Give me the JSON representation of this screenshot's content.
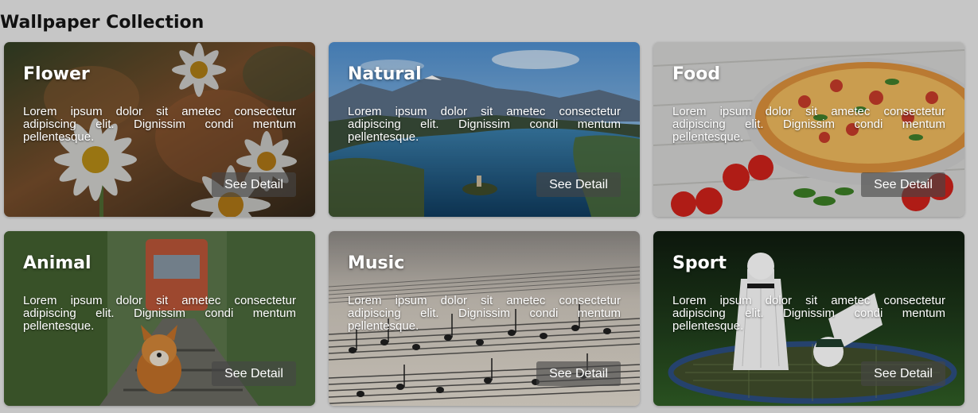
{
  "page": {
    "title": "Wallpaper Collection"
  },
  "cards": [
    {
      "title": "Flower",
      "description": "Lorem ipsum dolor sit ametec consectetur adipiscing elit. Dignissim condi mentum pellentesque.",
      "button": "See Detail"
    },
    {
      "title": "Natural",
      "description": "Lorem ipsum dolor sit ametec consectetur adipiscing elit. Dignissim condi mentum pellentesque.",
      "button": "See Detail"
    },
    {
      "title": "Food",
      "description": "Lorem ipsum dolor sit ametec consectetur adipiscing elit. Dignissim condi mentum pellentesque.",
      "button": "See Detail"
    },
    {
      "title": "Animal",
      "description": "Lorem ipsum dolor sit ametec consectetur adipiscing elit. Dignissim condi mentum pellentesque.",
      "button": "See Detail"
    },
    {
      "title": "Music",
      "description": "Lorem ipsum dolor sit ametec consectetur adipiscing elit. Dignissim condi mentum pellentesque.",
      "button": "See Detail"
    },
    {
      "title": "Sport",
      "description": "Lorem ipsum dolor sit ametec consectetur adipiscing elit. Dignissim condi mentum pellentesque.",
      "button": "See Detail"
    }
  ],
  "colors": {
    "page_background": "#c6c6c6",
    "button_background": "#464646",
    "text_light": "#ffffff"
  }
}
